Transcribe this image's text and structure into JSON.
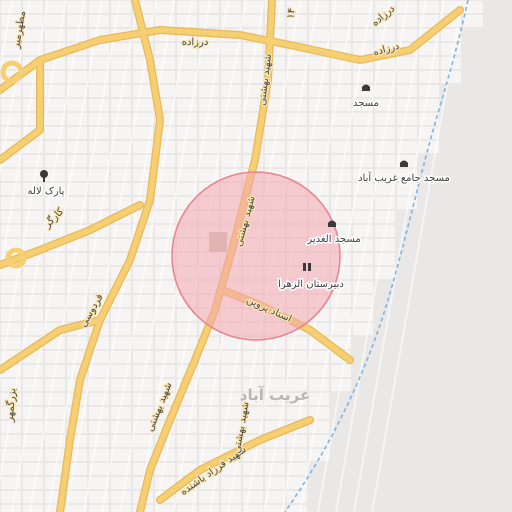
{
  "map": {
    "colors": {
      "background": "#e9e8e6",
      "block": "#f6f5f3",
      "road_major": "#f6cf72",
      "road_minor": "#ffffff",
      "water": "#7fb4e2",
      "radius_fill": "#f2a6b0",
      "radius_stroke": "#e6838f",
      "park": "#c9c7b2"
    },
    "highlight": {
      "type": "radius-circle"
    },
    "area_label": "غریب آباد",
    "pois": [
      {
        "name": "مسجد",
        "icon": "mosque-icon"
      },
      {
        "name": "مسجد جامع غریب آباد",
        "icon": "mosque-icon"
      },
      {
        "name": "مسجد الغدیر",
        "icon": "mosque-icon"
      },
      {
        "name": "دبیرستان الزهرا",
        "icon": "school-icon"
      },
      {
        "name": "پارک لاله",
        "icon": "tree-icon"
      }
    ],
    "streets": [
      "شهید بهشتی",
      "شهید بهشتی",
      "شهید بهشتی",
      "درزاده",
      "درزاده",
      "درزاده",
      "استاد پروین",
      "فردوسی",
      "کارگر",
      "بزرگمهر",
      "شهید فرزاد باشنده",
      "شهید بهشتی",
      "مطهرمیر",
      "۱۴"
    ]
  }
}
